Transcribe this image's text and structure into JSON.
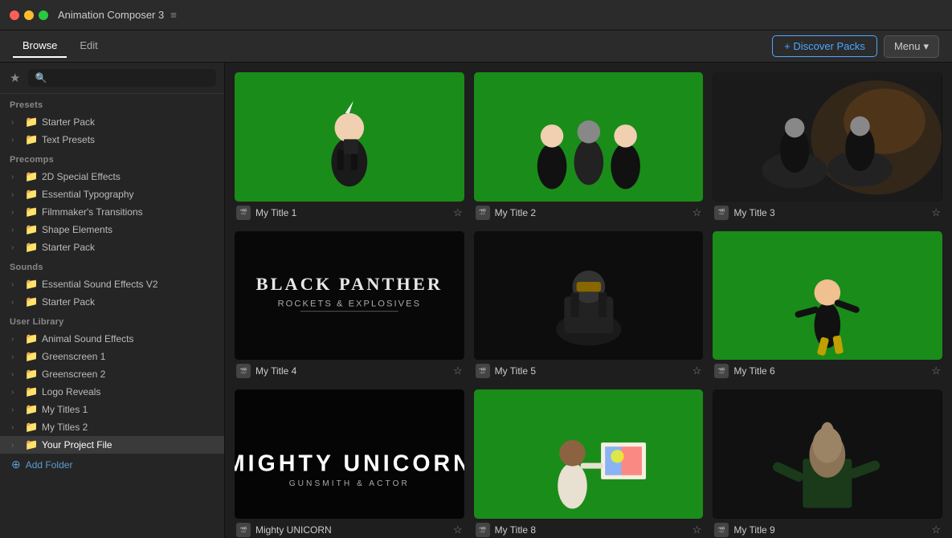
{
  "app": {
    "title": "Animation Composer 3",
    "tabs": [
      {
        "id": "browse",
        "label": "Browse",
        "active": true
      },
      {
        "id": "edit",
        "label": "Edit",
        "active": false
      }
    ],
    "discover_btn": "+ Discover Packs",
    "menu_btn": "Menu"
  },
  "search": {
    "placeholder": ""
  },
  "sidebar": {
    "sections": [
      {
        "id": "presets",
        "label": "Presets",
        "items": [
          {
            "id": "starter-pack-1",
            "label": "Starter Pack",
            "icon": "folder",
            "level": 1
          },
          {
            "id": "text-presets",
            "label": "Text Presets",
            "icon": "folder",
            "level": 1
          }
        ]
      },
      {
        "id": "precomps",
        "label": "Precomps",
        "items": [
          {
            "id": "2d-special",
            "label": "2D Special Effects",
            "icon": "folder",
            "level": 1
          },
          {
            "id": "essential-typography",
            "label": "Essential Typography",
            "icon": "folder",
            "level": 1
          },
          {
            "id": "filmmakers-transitions",
            "label": "Filmmaker's Transitions",
            "icon": "folder",
            "level": 1
          },
          {
            "id": "shape-elements",
            "label": "Shape Elements",
            "icon": "folder",
            "level": 1
          },
          {
            "id": "starter-pack-2",
            "label": "Starter Pack",
            "icon": "folder",
            "level": 1
          }
        ]
      },
      {
        "id": "sounds",
        "label": "Sounds",
        "items": [
          {
            "id": "essential-sound",
            "label": "Essential Sound Effects V2",
            "icon": "folder",
            "level": 1
          },
          {
            "id": "starter-pack-3",
            "label": "Starter Pack",
            "icon": "folder",
            "level": 1
          }
        ]
      },
      {
        "id": "user-library",
        "label": "User Library",
        "items": [
          {
            "id": "animal-sound",
            "label": "Animal Sound Effects",
            "icon": "folder",
            "level": 1
          },
          {
            "id": "greenscreen-1",
            "label": "Greenscreen 1",
            "icon": "folder",
            "level": 1
          },
          {
            "id": "greenscreen-2",
            "label": "Greenscreen 2",
            "icon": "folder",
            "level": 1
          },
          {
            "id": "logo-reveals",
            "label": "Logo Reveals",
            "icon": "folder",
            "level": 1
          },
          {
            "id": "my-titles-1",
            "label": "My Titles 1",
            "icon": "folder-purple",
            "level": 1
          },
          {
            "id": "my-titles-2",
            "label": "My Titles 2",
            "icon": "folder-purple",
            "level": 1
          },
          {
            "id": "your-project",
            "label": "Your Project File",
            "icon": "folder-purple",
            "level": 1,
            "selected": true
          }
        ]
      }
    ],
    "add_folder_label": "Add Folder"
  },
  "grid": {
    "items": [
      {
        "id": "title-1",
        "name": "My Title 1",
        "thumb_type": "green-unicorn-1",
        "starred": false
      },
      {
        "id": "title-2",
        "name": "My Title 2",
        "thumb_type": "green-group",
        "starred": false
      },
      {
        "id": "title-3",
        "name": "My Title 3",
        "thumb_type": "green-horses",
        "starred": false
      },
      {
        "id": "title-4",
        "name": "My Title 4",
        "thumb_type": "black-panther",
        "starred": false
      },
      {
        "id": "title-5",
        "name": "My Title 5",
        "thumb_type": "dark-sitting",
        "starred": false
      },
      {
        "id": "title-6",
        "name": "My Title 6",
        "thumb_type": "green-dancer",
        "starred": false
      },
      {
        "id": "title-7",
        "name": "Mighty UNICORN",
        "thumb_type": "black-mighty",
        "starred": false
      },
      {
        "id": "title-8",
        "name": "My Title 8",
        "thumb_type": "green-painter",
        "starred": false
      },
      {
        "id": "title-9",
        "name": "My Title 9",
        "thumb_type": "dark-presenter",
        "starred": false
      }
    ]
  },
  "colors": {
    "accent_blue": "#4da6ff",
    "green_screen": "#1a8c1a",
    "dark_bg": "#0a0a0a"
  }
}
